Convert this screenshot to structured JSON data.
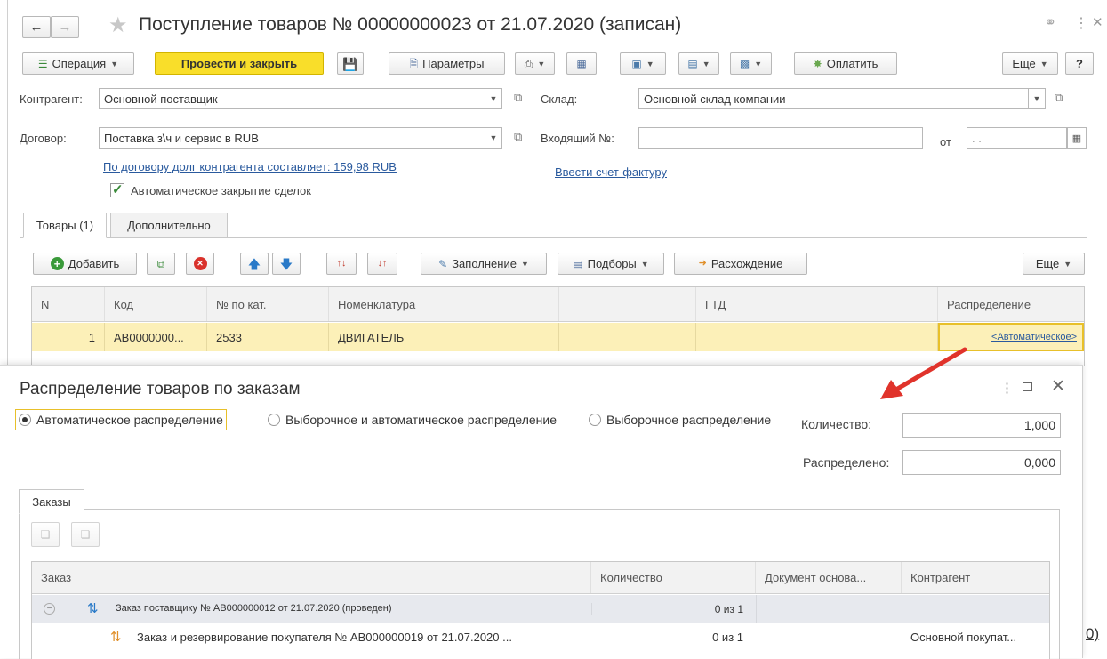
{
  "window": {
    "title": "Поступление товаров № 00000000023 от 21.07.2020 (записан)"
  },
  "toolbar": {
    "operation_label": "Операция",
    "post_close_label": "Провести и закрыть",
    "params_label": "Параметры",
    "pay_label": "Оплатить",
    "more_label": "Еще",
    "help_label": "?"
  },
  "form": {
    "counterparty_label": "Контрагент:",
    "counterparty_value": "Основной поставщик",
    "warehouse_label": "Склад:",
    "warehouse_value": "Основной склад компании",
    "contract_label": "Договор:",
    "contract_value": "Поставка з\\ч и сервис в RUB",
    "incoming_label": "Входящий №:",
    "incoming_value": "",
    "from_label": "от",
    "from_value": ". .",
    "debt_link": "По договору долг контрагента составляет: 159,98 RUB",
    "invoice_link": "Ввести счет-фактуру",
    "auto_close_label": "Автоматическое закрытие сделок",
    "auto_close_checked": true
  },
  "tabs": [
    {
      "label": "Товары (1)",
      "active": true
    },
    {
      "label": "Дополнительно",
      "active": false
    }
  ],
  "goods_toolbar": {
    "add_label": "Добавить",
    "fill_label": "Заполнение",
    "selections_label": "Подборы",
    "discrepancy_label": "Расхождение",
    "more_label": "Еще"
  },
  "goods_table": {
    "columns": [
      "N",
      "Код",
      "№ по кат.",
      "Номенклатура",
      "",
      "ГТД",
      "Распределение"
    ],
    "rows": [
      {
        "n": "1",
        "code": "АВ0000000...",
        "cat_no": "2533",
        "nomenclature": "ДВИГАТЕЛЬ",
        "extra": "",
        "gtd": "",
        "distribution": "<Автоматическое>"
      }
    ]
  },
  "dialog": {
    "title": "Распределение товаров по заказам",
    "radio_options": [
      {
        "label": "Автоматическое распределение",
        "selected": true
      },
      {
        "label": "Выборочное и автоматическое распределение",
        "selected": false
      },
      {
        "label": "Выборочное распределение",
        "selected": false
      }
    ],
    "quantity_label": "Количество:",
    "quantity_value": "1,000",
    "distributed_label": "Распределено:",
    "distributed_value": "0,000",
    "tab_orders": "Заказы",
    "columns": [
      "Заказ",
      "Количество",
      "Документ основа...",
      "Контрагент"
    ],
    "rows": [
      {
        "order": "Заказ поставщику № АВ000000012 от 21.07.2020 (проведен)",
        "quantity": "0 из 1",
        "document": "",
        "counterparty": ""
      },
      {
        "order": "Заказ и резервирование покупателя № АВ000000019 от 21.07.2020 ...",
        "quantity": "0 из 1",
        "document": "",
        "counterparty": "Основной покупат..."
      }
    ]
  },
  "background_fragment": "0)",
  "colors": {
    "accent_yellow": "#f9de2a",
    "selected_row": "#fcf0b8",
    "link_blue": "#2a5a9e",
    "arrow_red": "#e0332b"
  }
}
